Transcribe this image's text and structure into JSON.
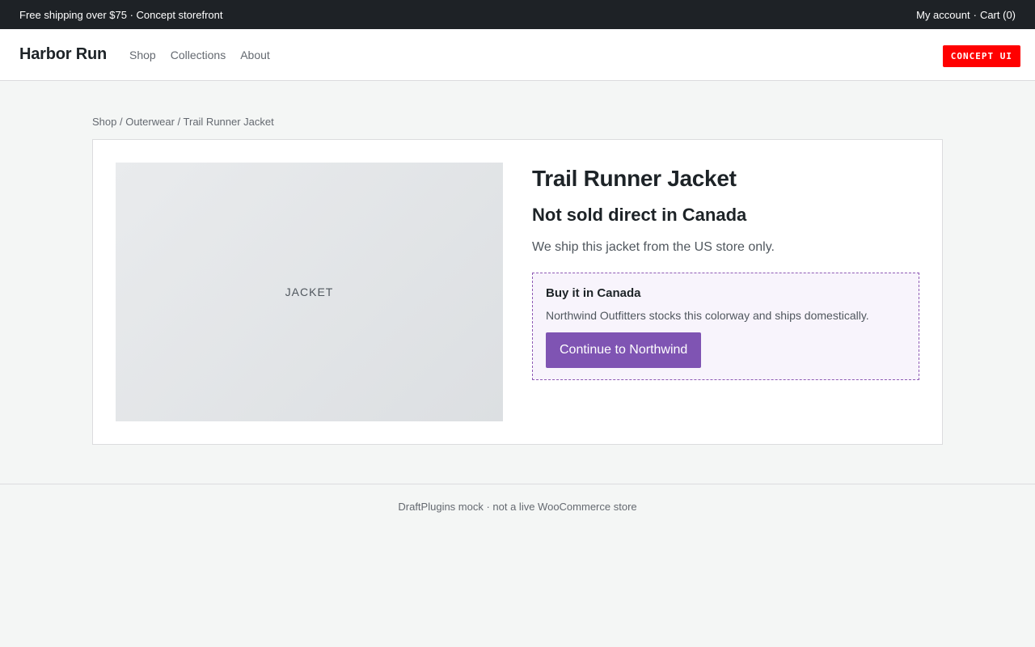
{
  "topbar": {
    "promo": "Free shipping over $75 · Concept storefront",
    "account_label": "My account",
    "separator": "·",
    "cart_label": "Cart (0)"
  },
  "header": {
    "brand": "Harbor Run",
    "nav": [
      "Shop",
      "Collections",
      "About"
    ],
    "badge": "CONCEPT UI"
  },
  "breadcrumb": {
    "items": [
      "Shop",
      "Outerwear",
      "Trail Runner Jacket"
    ],
    "separator": " / "
  },
  "product": {
    "image_label": "JACKET",
    "title": "Trail Runner Jacket",
    "notice_title": "Not sold direct in Canada",
    "notice_text": "We ship this jacket from the US store only."
  },
  "referral": {
    "title": "Buy it in Canada",
    "text": "Northwind Outfitters stocks this colorway and ships domestically.",
    "cta_label": "Continue to Northwind"
  },
  "footer": {
    "text": "DraftPlugins mock · not a live WooCommerce store"
  },
  "colors": {
    "topbar_bg": "#1e2226",
    "accent": "#7f54b3",
    "badge_bg": "#ff0000"
  }
}
